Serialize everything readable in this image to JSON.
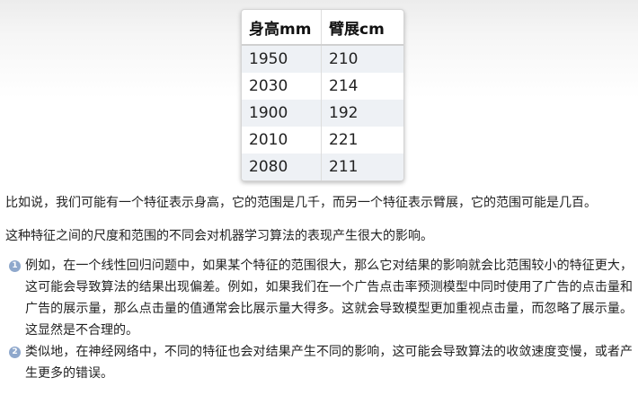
{
  "table": {
    "headers": [
      "身高mm",
      "臂展cm"
    ],
    "rows": [
      [
        "1950",
        "210"
      ],
      [
        "2030",
        "214"
      ],
      [
        "1900",
        "192"
      ],
      [
        "2010",
        "221"
      ],
      [
        "2080",
        "211"
      ]
    ]
  },
  "paragraphs": [
    "比如说，我们可能有一个特征表示身高，它的范围是几千，而另一个特征表示臂展，它的范围可能是几百。",
    "这种特征之间的尺度和范围的不同会对机器学习算法的表现产生很大的影响。"
  ],
  "list": [
    {
      "marker": "1",
      "text": "例如，在一个线性回归问题中，如果某个特征的范围很大，那么它对结果的影响就会比范围较小的特征更大，这可能会导致算法的结果出现偏差。例如，如果我们在一个广告点击率预测模型中同时使用了广告的点击量和广告的展示量，那么点击量的值通常会比展示量大得多。这就会导致模型更加重视点击量，而忽略了展示量。这显然是不合理的。"
    },
    {
      "marker": "2",
      "text": "类似地，在神经网络中，不同的特征也会对结果产生不同的影响，这可能会导致算法的收敛速度变慢，或者产生更多的错误。"
    }
  ],
  "colors": {
    "marker": "#8fa8cc",
    "row_stripe": "#eef1f5"
  }
}
